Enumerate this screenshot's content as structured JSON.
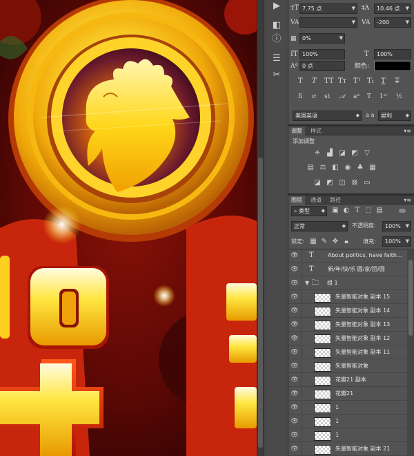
{
  "character": {
    "font_size": "7.75 点",
    "leading": "10.46 点",
    "kerning": "",
    "tracking": "-200",
    "tsume": "0%",
    "vertical_scale": "100%",
    "horizontal_scale": "100%",
    "baseline_shift": "0 点",
    "color_label": "颜色:",
    "color_value": "#000000",
    "language": "美国英语",
    "aa_label": "a a",
    "antialias": "犀利",
    "style_glyphs": [
      "T",
      "T",
      "TT",
      "Tт",
      "T¹",
      "T,",
      "T",
      "T"
    ],
    "ot_glyphs": [
      "fi",
      "ơ",
      "st",
      "A",
      "ad",
      "T",
      "1st",
      "½"
    ]
  },
  "adjustments": {
    "tabs": [
      "调整",
      "样式"
    ],
    "title": "添加调整",
    "icons_row1": [
      "brightness-icon",
      "levels-icon",
      "curves-icon",
      "exposure-icon",
      "vibrance-icon"
    ],
    "icons_row2": [
      "hue-saturation-icon",
      "color-balance-icon",
      "black-white-icon",
      "photo-filter-icon",
      "channel-mixer-icon",
      "color-lookup-icon"
    ],
    "icons_row3": [
      "invert-icon",
      "posterize-icon",
      "threshold-icon",
      "selective-color-icon",
      "gradient-map-icon"
    ]
  },
  "layers": {
    "tabs": [
      "图层",
      "通道",
      "路径"
    ],
    "filter_kind": "类型",
    "blend_mode": "正常",
    "opacity_label": "不透明度:",
    "opacity": "100%",
    "lock_label": "锁定:",
    "fill_label": "填充:",
    "fill": "100%",
    "items": [
      {
        "type": "text",
        "name": "About politics, have faith..."
      },
      {
        "type": "text",
        "name": "新/年/快/乐 圆/家/团/圆"
      },
      {
        "type": "group",
        "name": "组 1"
      },
      {
        "type": "smart",
        "name": "矢量智能对象 副本 15"
      },
      {
        "type": "smart",
        "name": "矢量智能对象 副本 14"
      },
      {
        "type": "smart",
        "name": "矢量智能对象 副本 13"
      },
      {
        "type": "smart",
        "name": "矢量智能对象 副本 12"
      },
      {
        "type": "smart",
        "name": "矢量智能对象 副本 11"
      },
      {
        "type": "smart",
        "name": "矢量智能对象"
      },
      {
        "type": "smart",
        "name": "花瓣21 副本"
      },
      {
        "type": "smart",
        "name": "花瓣21"
      },
      {
        "type": "smart",
        "name": "1"
      },
      {
        "type": "smart",
        "name": "1"
      },
      {
        "type": "smart",
        "name": "1"
      },
      {
        "type": "smart",
        "name": "矢量智能对象 副本 21"
      }
    ]
  },
  "colors": {
    "panel_bg": "#535353",
    "field_bg": "#3d3d3d",
    "text": "#e6e6e6",
    "canvas_gold": "#f7d21a",
    "canvas_red": "#c8200a"
  }
}
